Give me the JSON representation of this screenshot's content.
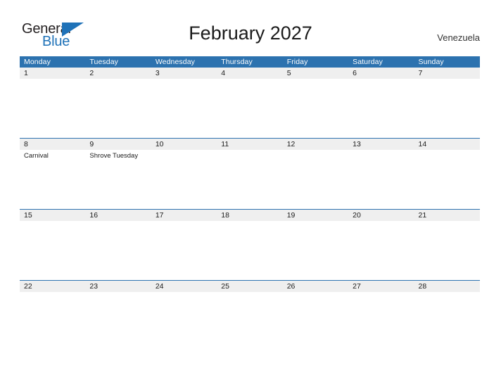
{
  "logo": {
    "word_one": "General",
    "word_two": "Blue",
    "triangle_icon": "triangle-icon",
    "primary_color": "#1f72b8",
    "text_color": "#231f20"
  },
  "header": {
    "title": "February 2027",
    "country": "Venezuela"
  },
  "calendar": {
    "accent_color": "#2c72af",
    "date_strip_color": "#efefef",
    "weekdays": [
      "Monday",
      "Tuesday",
      "Wednesday",
      "Thursday",
      "Friday",
      "Saturday",
      "Sunday"
    ],
    "weeks": [
      {
        "rule": false,
        "days": [
          {
            "date": "1",
            "events": []
          },
          {
            "date": "2",
            "events": []
          },
          {
            "date": "3",
            "events": []
          },
          {
            "date": "4",
            "events": []
          },
          {
            "date": "5",
            "events": []
          },
          {
            "date": "6",
            "events": []
          },
          {
            "date": "7",
            "events": []
          }
        ]
      },
      {
        "rule": true,
        "days": [
          {
            "date": "8",
            "events": [
              "Carnival"
            ]
          },
          {
            "date": "9",
            "events": [
              "Shrove Tuesday"
            ]
          },
          {
            "date": "10",
            "events": []
          },
          {
            "date": "11",
            "events": []
          },
          {
            "date": "12",
            "events": []
          },
          {
            "date": "13",
            "events": []
          },
          {
            "date": "14",
            "events": []
          }
        ]
      },
      {
        "rule": true,
        "days": [
          {
            "date": "15",
            "events": []
          },
          {
            "date": "16",
            "events": []
          },
          {
            "date": "17",
            "events": []
          },
          {
            "date": "18",
            "events": []
          },
          {
            "date": "19",
            "events": []
          },
          {
            "date": "20",
            "events": []
          },
          {
            "date": "21",
            "events": []
          }
        ]
      },
      {
        "rule": true,
        "days": [
          {
            "date": "22",
            "events": []
          },
          {
            "date": "23",
            "events": []
          },
          {
            "date": "24",
            "events": []
          },
          {
            "date": "25",
            "events": []
          },
          {
            "date": "26",
            "events": []
          },
          {
            "date": "27",
            "events": []
          },
          {
            "date": "28",
            "events": []
          }
        ]
      }
    ]
  }
}
